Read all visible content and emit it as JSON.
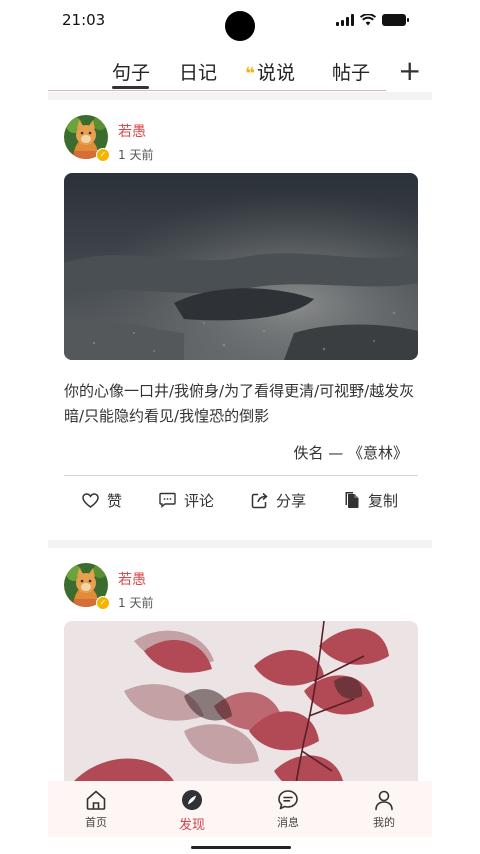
{
  "status_bar": {
    "time": "21:03"
  },
  "tabs": {
    "items": [
      {
        "label": "句子"
      },
      {
        "label": "日记"
      },
      {
        "label": "说说",
        "quote_mark": "❝"
      },
      {
        "label": "帖子"
      }
    ],
    "active_index": 0,
    "add_label": "+"
  },
  "posts": [
    {
      "author": "若愚",
      "time": "1 天前",
      "verified": true,
      "quote": "你的心像一口井/我俯身/为了看得更清/可视野/越发灰暗/只能隐约看见/我惶恐的倒影",
      "source": "佚名 — 《意林》",
      "actions": {
        "like": "赞",
        "comment": "评论",
        "share": "分享",
        "copy": "复制"
      }
    },
    {
      "author": "若愚",
      "time": "1 天前",
      "verified": true
    }
  ],
  "bottom_nav": {
    "items": [
      {
        "label": "首页",
        "icon": "home-icon"
      },
      {
        "label": "发现",
        "icon": "compass-icon"
      },
      {
        "label": "消息",
        "icon": "chat-bubble-icon"
      },
      {
        "label": "我的",
        "icon": "person-icon"
      }
    ],
    "active_index": 1
  },
  "colors": {
    "accent": "#e0484c",
    "verified_badge": "#f4b400",
    "quote_mark": "#f0b21a",
    "nav_background": "#fdf6f4"
  }
}
